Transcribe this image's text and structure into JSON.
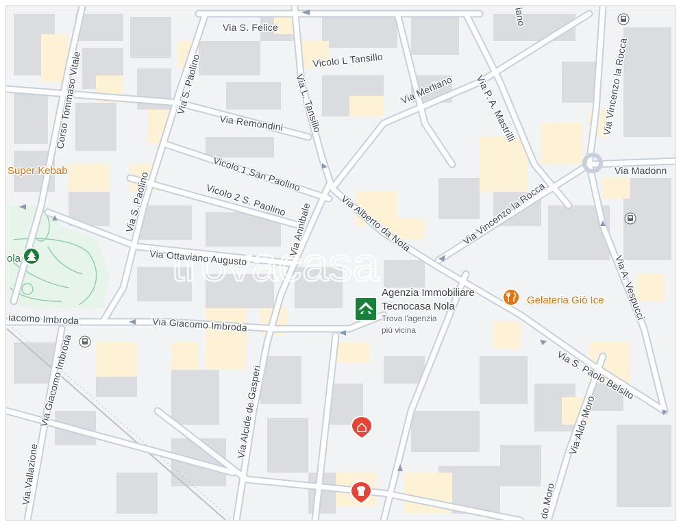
{
  "map": {
    "watermark": "trovacasa",
    "colors": {
      "background": "#f1f3f4",
      "block": "#e8eaed",
      "building": "#dadce0",
      "building_warm": "#fdf2d6",
      "road": "#ffffff",
      "road_casing": "#c6d0dc",
      "park": "#e6f4ea",
      "park_outline": "#8ed1a6",
      "rail": "#bdc1c6"
    },
    "street_labels": [
      {
        "id": "via-s-felice",
        "text": "Via S. Felice"
      },
      {
        "id": "vicolo-l-tansillo",
        "text": "Vicolo L Tansillo"
      },
      {
        "id": "via-l-tansillo",
        "text": "Via L. Tansillo"
      },
      {
        "id": "via-merliano",
        "text": "Via Merliano"
      },
      {
        "id": "via-p-a-mastrilli",
        "text": "Via P. A. Mastrilli"
      },
      {
        "id": "via-vincenzo-la-rocca-north",
        "text": "Via Vincenzo la Rocca"
      },
      {
        "id": "via-vincenzo-la-rocca-south",
        "text": "Via Vincenzo la Rocca"
      },
      {
        "id": "corso-tommaso-vitale",
        "text": "Corso Tommaso Vitale"
      },
      {
        "id": "via-s-paolino-north",
        "text": "Via S. Paolino"
      },
      {
        "id": "via-s-paolino-south",
        "text": "Via S. Paolino"
      },
      {
        "id": "via-remondini",
        "text": "Via Remondini"
      },
      {
        "id": "vicolo-1-san-paolino",
        "text": "Vicolo 1 San Paolino"
      },
      {
        "id": "vicolo-2-s-paolino",
        "text": "Vicolo 2 S. Paolino"
      },
      {
        "id": "via-annibale",
        "text": "Via Annibale"
      },
      {
        "id": "via-alberto-da-nola",
        "text": "Via Alberto da Nola"
      },
      {
        "id": "via-madonna",
        "text": "Via Madonn"
      },
      {
        "id": "via-ottaviano-augusto",
        "text": "Via Ottaviano Augusto"
      },
      {
        "id": "via-a-vespucci",
        "text": "Via A. Vespucci"
      },
      {
        "id": "via-giacomo-imbroda-west",
        "text": "iacomo Imbroda"
      },
      {
        "id": "via-giacomo-imbroda",
        "text": "Via Giacomo Imbroda"
      },
      {
        "id": "via-giacomo-imbroda-diag",
        "text": "Via Giacomo Imbroda"
      },
      {
        "id": "via-s-paolo-belsito",
        "text": "Via S. Paolo Belsito"
      },
      {
        "id": "via-alcide-de-gasperi",
        "text": "Via Alcide de Gasperi"
      },
      {
        "id": "via-aldo-moro",
        "text": "Via Aldo Moro"
      },
      {
        "id": "via-aldo-moro-south",
        "text": "do Moro"
      },
      {
        "id": "via-vallazione",
        "text": "Via Vallazione"
      },
      {
        "id": "via-top-right-partial",
        "text": "iano"
      }
    ],
    "pois": [
      {
        "id": "super-kebab",
        "label": "Super Kebab",
        "icon": "fork-knife-icon",
        "color": "#e8710a"
      },
      {
        "id": "gelateria-gio-ice",
        "label": "Gelateria Giò Ice",
        "icon": "fork-knife-icon",
        "color": "#e8710a"
      },
      {
        "id": "park",
        "label": "ola",
        "icon": "tree-icon",
        "color": "#188038"
      },
      {
        "id": "shop-red-1",
        "label": "",
        "icon": "shopping-bag-icon",
        "color": "#ea4335"
      },
      {
        "id": "shop-red-2",
        "label": "",
        "icon": "clothing-icon",
        "color": "#ea4335"
      }
    ],
    "agency": {
      "name_line1": "Agenzia Immobiliare",
      "name_line2": "Tecnocasa Nola",
      "sub_line1": "Trova l'agenzia",
      "sub_line2": "più vicina",
      "icon": "house-marker-icon",
      "color": "#188038"
    },
    "transit_icons": [
      {
        "id": "bus-stop-1",
        "icon": "bus-icon"
      },
      {
        "id": "bus-stop-2",
        "icon": "bus-icon"
      },
      {
        "id": "bus-stop-3",
        "icon": "bus-icon"
      }
    ]
  }
}
